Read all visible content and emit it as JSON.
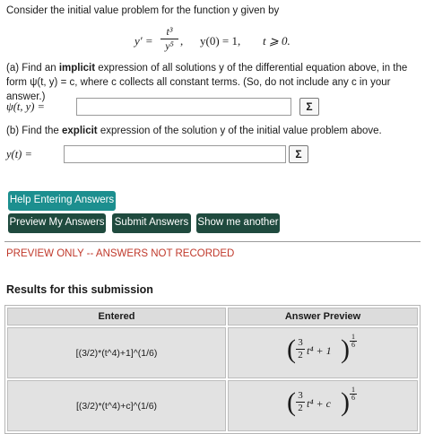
{
  "problem": {
    "intro": "Consider the initial value problem for the function y given by",
    "equation": {
      "lhs": "y′ =",
      "numerator": "t³",
      "denominator": "y⁵",
      "comma": ",",
      "initial_condition": "y(0) = 1,",
      "condition": "t ⩾ 0."
    },
    "part_a": {
      "pre": "(a) Find an ",
      "bold": "implicit",
      "post": " expression of all solutions y of the differential equation above, in the form ψ(t, y) = c, where c collects all constant terms. (So, do not include any c in your answer.)",
      "label": "ψ(t, y) =",
      "value": ""
    },
    "part_b": {
      "pre": "(b) Find the ",
      "bold": "explicit",
      "post": " expression of the solution y of the initial value problem above.",
      "label": "y(t) =",
      "value": ""
    },
    "sigma_label": "Σ"
  },
  "buttons": {
    "help": "Help Entering Answers",
    "preview": "Preview My Answers",
    "submit": "Submit Answers",
    "show_another": "Show me another"
  },
  "status": {
    "preview_message": "PREVIEW ONLY -- ANSWERS NOT RECORDED"
  },
  "results": {
    "title": "Results for this submission",
    "headers": [
      "Entered",
      "Answer Preview"
    ],
    "rows": [
      {
        "entered": "[(3/2)*(t^4)+1]^(1/6)",
        "preview": {
          "coef_num": "3",
          "coef_den": "2",
          "term": "t⁴ + 1",
          "exp_num": "1",
          "exp_den": "6"
        }
      },
      {
        "entered": "[(3/2)*(t^4)+c]^(1/6)",
        "preview": {
          "coef_num": "3",
          "coef_den": "2",
          "term": "t⁴ + c",
          "exp_num": "1",
          "exp_den": "6"
        }
      }
    ]
  },
  "colors": {
    "help_button": "#1c8f8f",
    "action_buttons": "#1f4a3e",
    "preview_message": "#c0392b",
    "table_cell": "#e2e2e2"
  }
}
